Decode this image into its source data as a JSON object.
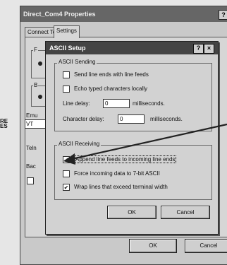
{
  "outer_window": {
    "title": "Direct_Com4 Properties",
    "help_glyph": "?",
    "tabs": [
      {
        "label": "Connect To"
      },
      {
        "label": "Settings"
      }
    ],
    "stub_labels": [
      "F",
      "B",
      "Emu",
      "Teln",
      "Bac"
    ],
    "vt_value": "VT",
    "left_edge_text": [
      "RE",
      "ES"
    ],
    "buttons": {
      "ok": "OK",
      "cancel": "Cancel"
    }
  },
  "dialog": {
    "title": "ASCII Setup",
    "help_glyph": "?",
    "close_glyph": "×",
    "sending": {
      "group_label": "ASCII Sending",
      "options": [
        {
          "label": "Send line ends with line feeds",
          "checked": false
        },
        {
          "label": "Echo typed characters locally",
          "checked": false
        }
      ],
      "line_delay": {
        "label": "Line delay:",
        "value": "0",
        "unit": "milliseconds."
      },
      "character_delay": {
        "label": "Character delay:",
        "value": "0",
        "unit": "milliseconds."
      }
    },
    "receiving": {
      "group_label": "ASCII Receiving",
      "options": [
        {
          "label": "Append line feeds to incoming line ends",
          "checked": true,
          "check_mark": "✔"
        },
        {
          "label": "Force incoming data to 7-bit ASCII",
          "checked": false,
          "check_mark": ""
        },
        {
          "label": "Wrap lines that exceed terminal width",
          "checked": true,
          "check_mark": "✔"
        }
      ]
    },
    "buttons": {
      "ok": "OK",
      "cancel": "Cancel"
    }
  },
  "annotation": {
    "icon": "arrow-icon",
    "color": "#222222"
  }
}
